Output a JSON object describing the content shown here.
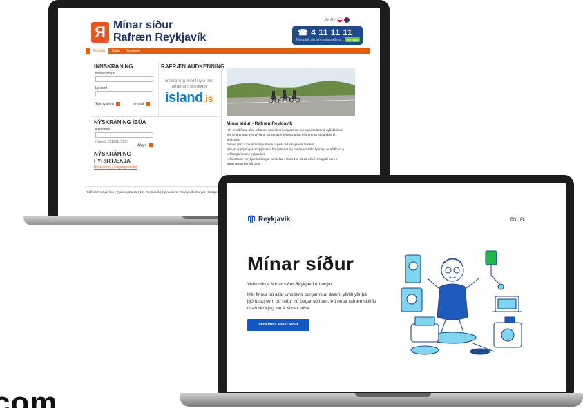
{
  "old_site": {
    "brand_line1": "Mínar síður",
    "brand_line2": "Rafræn Reykjavík",
    "font_size_controls": "A- A+",
    "phone": "☎ 4 11 11 11",
    "phone_sub": "Netspjall við þjónustuborðina",
    "chat_button": "Hjá ykkur",
    "nav": [
      "Forsíða",
      "Hjálp",
      "Umsóknir"
    ],
    "login": {
      "heading": "INNSKRÁNING",
      "username_label": "Notandanafn",
      "password_label": "Lykilorð",
      "forgot": "Týnt lykilorð",
      "submit": "Innskrá"
    },
    "eid": {
      "heading": "RAFRÆN AUDKENNING",
      "text": "Innskráning með Íslykli eða rafrænum skilríkjum",
      "logo_main": "island",
      "logo_suffix": ".is"
    },
    "registration": {
      "heading": "NÝSKRÁNING ÍBÚA",
      "kennitala_label": "Kennitala",
      "example": "(Dæmi: 0110012230)",
      "next": "Áfram"
    },
    "company": {
      "heading_line1": "NÝSKRÁNING",
      "heading_line2": "FYRIRTÆKJA",
      "link": "Nýskráning / Aðgangsbeiðni"
    },
    "article": {
      "title": "Mínar síður - Rafræn Reykjavík",
      "lines": [
        "Hér er að finna allar rafrænar umsóknir borgarinnar svo og umsóknir á eyðublöðum",
        "sem má annað hvort fylla út og senda með tölvupósti eða prenta út og skila til",
        "skrifstofa.",
        "Ekki er þörf á innskráningu nema til þess að sækja um rafrænt.",
        "Nánari upplýsingar um þjónustu borgarinnar og hverja umsókn fyrir sig er að finna á",
        "vef borgarinnar, reykjavik.is.",
        "Þjónustuver Reykjavíkurborgar aðstoðar í síma 411 11 11 eða í netspjalli sem er",
        "aðgengilegt hér að ofan."
      ]
    },
    "footer": "Ráðhús Reykjavíkur | Tjarnargötu 11 | 101 Reykjavík | Þjónustuver Reykjavíkurborgar | Borgart"
  },
  "new_site": {
    "brand": "Reykjavík",
    "lang_en": "EN",
    "lang_pl": "PL",
    "title": "Mínar síður",
    "welcome": "Velkomin á Mínar síður Reykjavíkurborgar.",
    "paragraph_lines": [
      "Hér finnur þú allar umsóknir borgarinnar ásamt yfirliti yfir þá",
      "þjónustu sem þú hefur nú þegar sótt um. Þú notar rafræn skilríki",
      "til að skrá þig inn á Mínar síður."
    ],
    "cta": "Skrá inn á Mínar síður"
  },
  "corner_text": "com",
  "colors": {
    "old_orange": "#e35f0f",
    "old_navy": "#1d3263",
    "new_blue": "#1357c2"
  }
}
